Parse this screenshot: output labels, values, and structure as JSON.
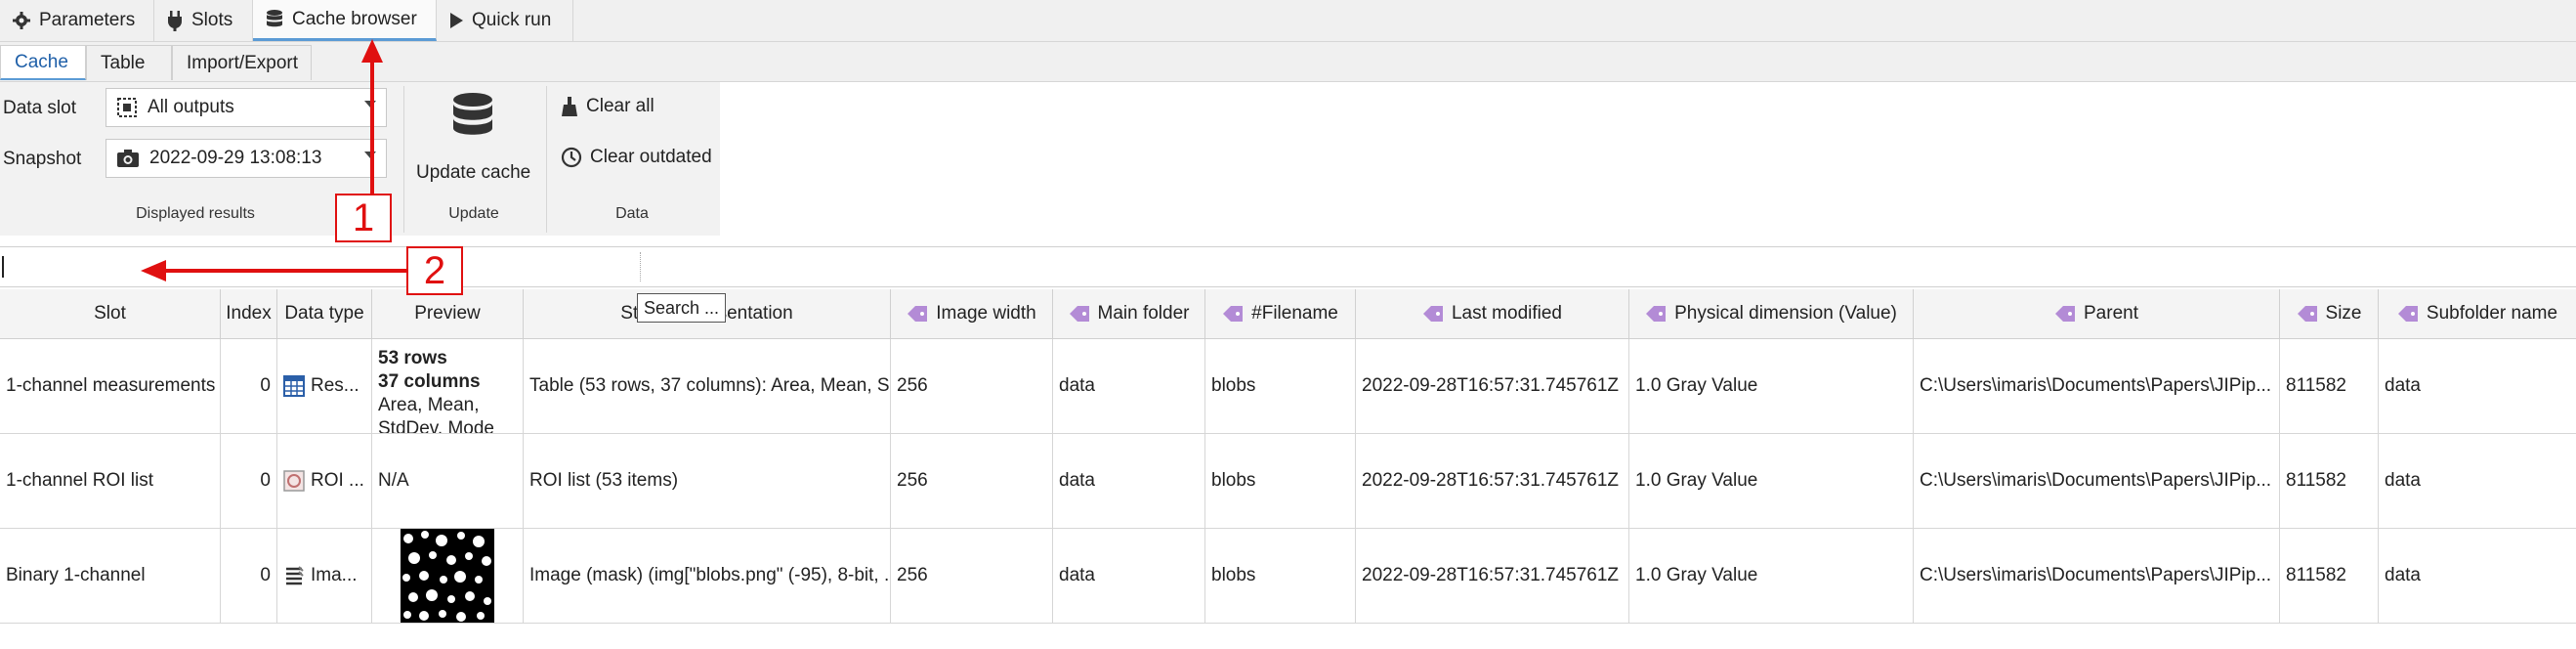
{
  "colors": {
    "accent": "#5b9bd5",
    "annotation": "#e01010",
    "tag": "#b38bd6"
  },
  "top_tabs": [
    {
      "label": "Parameters",
      "icon": "gear-icon"
    },
    {
      "label": "Slots",
      "icon": "plug-icon"
    },
    {
      "label": "Cache browser",
      "icon": "database-icon",
      "active": true
    },
    {
      "label": "Quick run",
      "icon": "play-icon"
    }
  ],
  "sub_tabs": [
    {
      "label": "Cache",
      "active": true
    },
    {
      "label": "Table"
    },
    {
      "label": "Import/Export"
    }
  ],
  "ribbon": {
    "data_slot_label": "Data slot",
    "data_slot_value": "All outputs",
    "snapshot_label": "Snapshot",
    "snapshot_value": "2022-09-29 13:08:13",
    "displayed_results_label": "Displayed results",
    "update_cache_label": "Update cache",
    "update_group_label": "Update",
    "clear_all_label": "Clear all",
    "clear_outdated_label": "Clear outdated",
    "data_group_label": "Data"
  },
  "search": {
    "tooltip": "Search ..."
  },
  "annotations": {
    "callout_1": "1",
    "callout_2": "2"
  },
  "table": {
    "headers": {
      "slot": "Slot",
      "index": "Index",
      "data_type": "Data type",
      "preview": "Preview",
      "string_representation": "String representation",
      "image_width": "Image width",
      "main_folder": "Main folder",
      "filename": "#Filename",
      "last_modified": "Last modified",
      "physical_dimension": "Physical dimension (Value)",
      "parent": "Parent",
      "size": "Size",
      "subfolder_name": "Subfolder name"
    },
    "rows": [
      {
        "slot": "1-channel measurements",
        "index": "0",
        "data_type": "Res...",
        "preview_line1": "53 rows",
        "preview_line2": "37 columns",
        "preview_line3": "Area, Mean,",
        "preview_line4": "StdDev, Mode",
        "string_representation": "Table (53 rows, 37 columns): Area, Mean, S...",
        "image_width": "256",
        "main_folder": "data",
        "filename": "blobs",
        "last_modified": "2022-09-28T16:57:31.745761Z",
        "physical_dimension": "1.0 Gray Value",
        "parent": "C:\\Users\\imaris\\Documents\\Papers\\JIPip...",
        "size": "811582",
        "subfolder_name": "data"
      },
      {
        "slot": "1-channel ROI list",
        "index": "0",
        "data_type": "ROI ...",
        "preview": "N/A",
        "string_representation": "ROI list (53 items)",
        "image_width": "256",
        "main_folder": "data",
        "filename": "blobs",
        "last_modified": "2022-09-28T16:57:31.745761Z",
        "physical_dimension": "1.0 Gray Value",
        "parent": "C:\\Users\\imaris\\Documents\\Papers\\JIPip...",
        "size": "811582",
        "subfolder_name": "data"
      },
      {
        "slot": "Binary 1-channel",
        "index": "0",
        "data_type": "Ima...",
        "string_representation": "Image (mask) (img[\"blobs.png\" (-95), 8-bit, ...",
        "image_width": "256",
        "main_folder": "data",
        "filename": "blobs",
        "last_modified": "2022-09-28T16:57:31.745761Z",
        "physical_dimension": "1.0 Gray Value",
        "parent": "C:\\Users\\imaris\\Documents\\Papers\\JIPip...",
        "size": "811582",
        "subfolder_name": "data"
      }
    ]
  }
}
